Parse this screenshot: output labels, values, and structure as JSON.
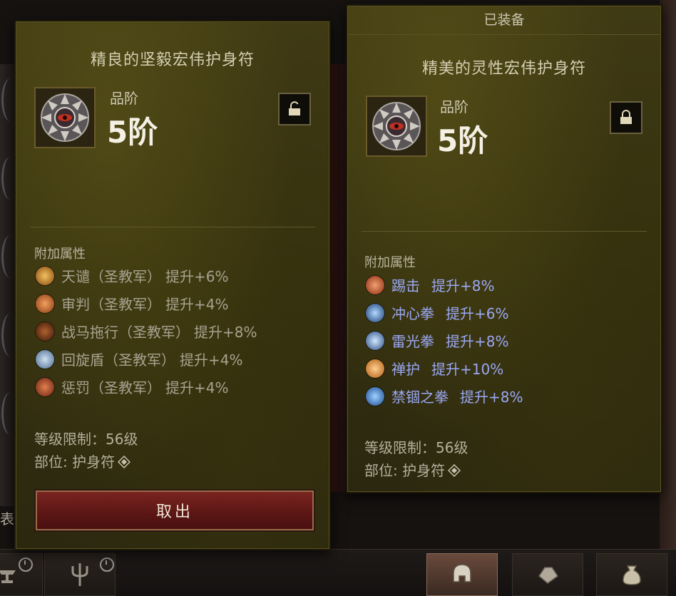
{
  "background": {
    "left_char": "表"
  },
  "left_panel": {
    "title": "精良的坚毅宏伟护身符",
    "grade_label": "品阶",
    "grade_value": "5阶",
    "lock_state": "unlocked",
    "section_label": "附加属性",
    "affixes": [
      {
        "icon": "judgment-sky-icon",
        "name": "天谴（圣教军）",
        "value": "提升+6%",
        "color": "#c89040"
      },
      {
        "icon": "judgment-icon",
        "name": "审判（圣教军）",
        "value": "提升+4%",
        "color": "#c87040"
      },
      {
        "icon": "steed-charge-icon",
        "name": "战马拖行（圣教军）",
        "value": "提升+8%",
        "color": "#7a3a20"
      },
      {
        "icon": "blessed-shield-icon",
        "name": "回旋盾（圣教军）",
        "value": "提升+4%",
        "color": "#8aa0c0"
      },
      {
        "icon": "punish-icon",
        "name": "惩罚（圣教军）",
        "value": "提升+4%",
        "color": "#b05030"
      }
    ],
    "level_req": "等级限制：56级",
    "slot": "部位: 护身符",
    "take_out_button": "取出"
  },
  "right_panel": {
    "equipped_label": "已装备",
    "title": "精美的灵性宏伟护身符",
    "grade_label": "品阶",
    "grade_value": "5阶",
    "lock_state": "locked",
    "section_label": "附加属性",
    "affixes": [
      {
        "icon": "kick-icon",
        "name": "踢击",
        "value": "提升+8%",
        "color": "#c05030"
      },
      {
        "icon": "crippling-wave-icon",
        "name": "冲心拳",
        "value": "提升+6%",
        "color": "#3a70b0"
      },
      {
        "icon": "lightning-fist-icon",
        "name": "雷光拳",
        "value": "提升+8%",
        "color": "#5080c0"
      },
      {
        "icon": "serenity-icon",
        "name": "禅护",
        "value": "提升+10%",
        "color": "#d07a20"
      },
      {
        "icon": "forbidden-fist-icon",
        "name": "禁锢之拳",
        "value": "提升+8%",
        "color": "#3a80d0"
      }
    ],
    "level_req": "等级限制：56级",
    "slot": "部位: 护身符"
  },
  "colors": {
    "panel_bg": "#3a3512",
    "grey_text": "#a8a290",
    "blue_text": "#9aa8f4",
    "button_red": "#6a1c18"
  }
}
